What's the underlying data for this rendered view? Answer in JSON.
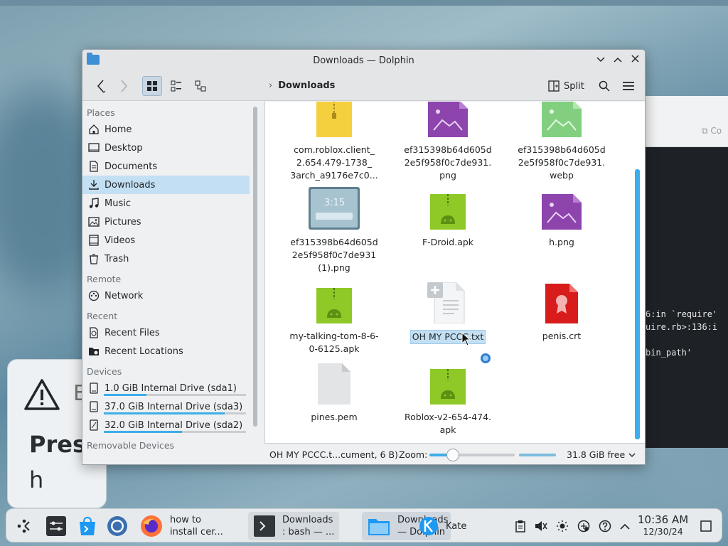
{
  "window": {
    "title": "Downloads — Dolphin",
    "minimize": "⌵",
    "maximize": "⌃",
    "close": "✕"
  },
  "toolbar": {
    "breadcrumb_sep": "›",
    "breadcrumb": "Downloads",
    "split_label": "Split"
  },
  "sidebar": {
    "sections": {
      "places": "Places",
      "remote": "Remote",
      "recent": "Recent",
      "devices": "Devices",
      "removable": "Removable Devices"
    },
    "places": [
      {
        "label": "Home",
        "icon": "home-icon"
      },
      {
        "label": "Desktop",
        "icon": "desktop-icon"
      },
      {
        "label": "Documents",
        "icon": "documents-icon"
      },
      {
        "label": "Downloads",
        "icon": "downloads-icon",
        "selected": true
      },
      {
        "label": "Music",
        "icon": "music-icon"
      },
      {
        "label": "Pictures",
        "icon": "pictures-icon"
      },
      {
        "label": "Videos",
        "icon": "videos-icon"
      },
      {
        "label": "Trash",
        "icon": "trash-icon"
      }
    ],
    "remote": [
      {
        "label": "Network",
        "icon": "network-icon"
      }
    ],
    "recent": [
      {
        "label": "Recent Files",
        "icon": "recent-files-icon"
      },
      {
        "label": "Recent Locations",
        "icon": "recent-locations-icon"
      }
    ],
    "devices": [
      {
        "label": "1.0 GiB Internal Drive (sda1)",
        "usage": 0.3
      },
      {
        "label": "37.0 GiB Internal Drive (sda3)",
        "usage": 0.85
      },
      {
        "label": "32.0 GiB Internal Drive (sda2)",
        "usage": 0.55
      }
    ]
  },
  "files": [
    {
      "line1": "com.roblox.client_",
      "line2": "2.654.479-1738_",
      "line3": "3arch_a9176e7c0...",
      "icon": "archive-icon"
    },
    {
      "line1": "ef315398b64d605d",
      "line2": "2e5f958f0c7de931.",
      "line3": "png",
      "icon": "image-icon"
    },
    {
      "line1": "ef315398b64d605d",
      "line2": "2e5f958f0c7de931.",
      "line3": "webp",
      "icon": "image-icon"
    },
    {
      "line1": "ef315398b64d605d",
      "line2": "2e5f958f0c7de931",
      "line3": "(1).png",
      "icon": "screenshot-thumbnail",
      "thumb_text": "3:15"
    },
    {
      "line1": "F-Droid.apk",
      "icon": "apk-icon"
    },
    {
      "line1": "h.png",
      "icon": "image-icon"
    },
    {
      "line1": "my-talking-tom-8-6-",
      "line2": "0-6125.apk",
      "icon": "apk-icon"
    },
    {
      "line1": "OH MY PCCC.txt",
      "icon": "text-file-icon",
      "selected": true
    },
    {
      "line1": "penis.crt",
      "icon": "certificate-icon"
    },
    {
      "line1": "pines.pem",
      "icon": "generic-file-icon"
    },
    {
      "line1": "Roblox-v2-654-474.",
      "line2": "apk",
      "icon": "apk-icon"
    }
  ],
  "statusbar": {
    "info": "OH MY PCCC.t...cument, 6 B)",
    "zoom_label": "Zoom:",
    "zoom_level": 0.27,
    "free_space": "31.8 GiB free"
  },
  "taskbar": {
    "items": [
      {
        "label1": "how to",
        "label2": "install cer...",
        "icon": "firefox-icon"
      },
      {
        "label1": "Downloads",
        "label2": ": bash — ...",
        "icon": "terminal-icon"
      },
      {
        "label1": "Downloads",
        "label2": "— Dolphin",
        "icon": "dolphin-icon",
        "active": true
      },
      {
        "label1": "Kate",
        "icon": "kate-icon"
      }
    ],
    "time": "10:36 AM",
    "date": "12/30/24"
  },
  "background": {
    "dialog_letter": "E",
    "dialog_text1": "Pres",
    "dialog_text2": "h",
    "side_copy": "Co",
    "terminal_lines": [
      "6:in `require'",
      "uire.rb>:136:i",
      "",
      "bin_path'"
    ]
  },
  "colors": {
    "accent": "#3daee9",
    "selection": "#c3dff3",
    "apk_green": "#8ec927",
    "image_purple": "#8e44ad",
    "archive_yellow": "#f4d03f",
    "cert_red": "#d81b1b"
  }
}
